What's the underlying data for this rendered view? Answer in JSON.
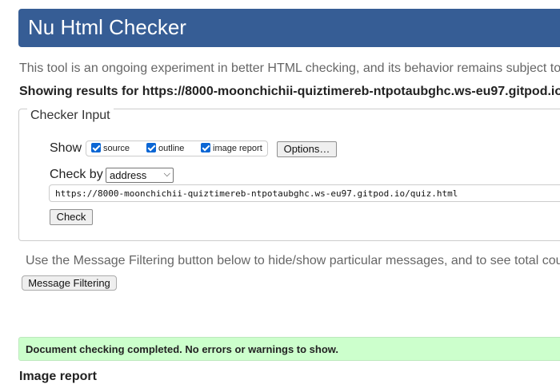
{
  "header": {
    "title": "Nu Html Checker"
  },
  "intro_text": "This tool is an ongoing experiment in better HTML checking, and its behavior remains subject to",
  "showing": {
    "prefix": "Showing results for ",
    "url": "https://8000-moonchichii-quiztimereb-ntpotaubghc.ws-eu97.gitpod.io"
  },
  "checker_input": {
    "legend": "Checker Input",
    "show_label": "Show",
    "options": [
      {
        "label": "source",
        "checked": true
      },
      {
        "label": "outline",
        "checked": true
      },
      {
        "label": "image report",
        "checked": true
      }
    ],
    "options_button": "Options…",
    "check_by_label": "Check by",
    "check_by_value": "address",
    "url_value": "https://8000-moonchichii-quiztimereb-ntpotaubghc.ws-eu97.gitpod.io/quiz.html",
    "check_button": "Check"
  },
  "filter_note": "Use the Message Filtering button below to hide/show particular messages, and to see total cou",
  "message_filtering_button": "Message Filtering",
  "result_message": "Document checking completed. No errors or warnings to show.",
  "image_report_heading": "Image report",
  "colors": {
    "header_bg": "#365d95",
    "success_bg": "#ccffcc",
    "checkbox_accent": "#0b66d4"
  }
}
